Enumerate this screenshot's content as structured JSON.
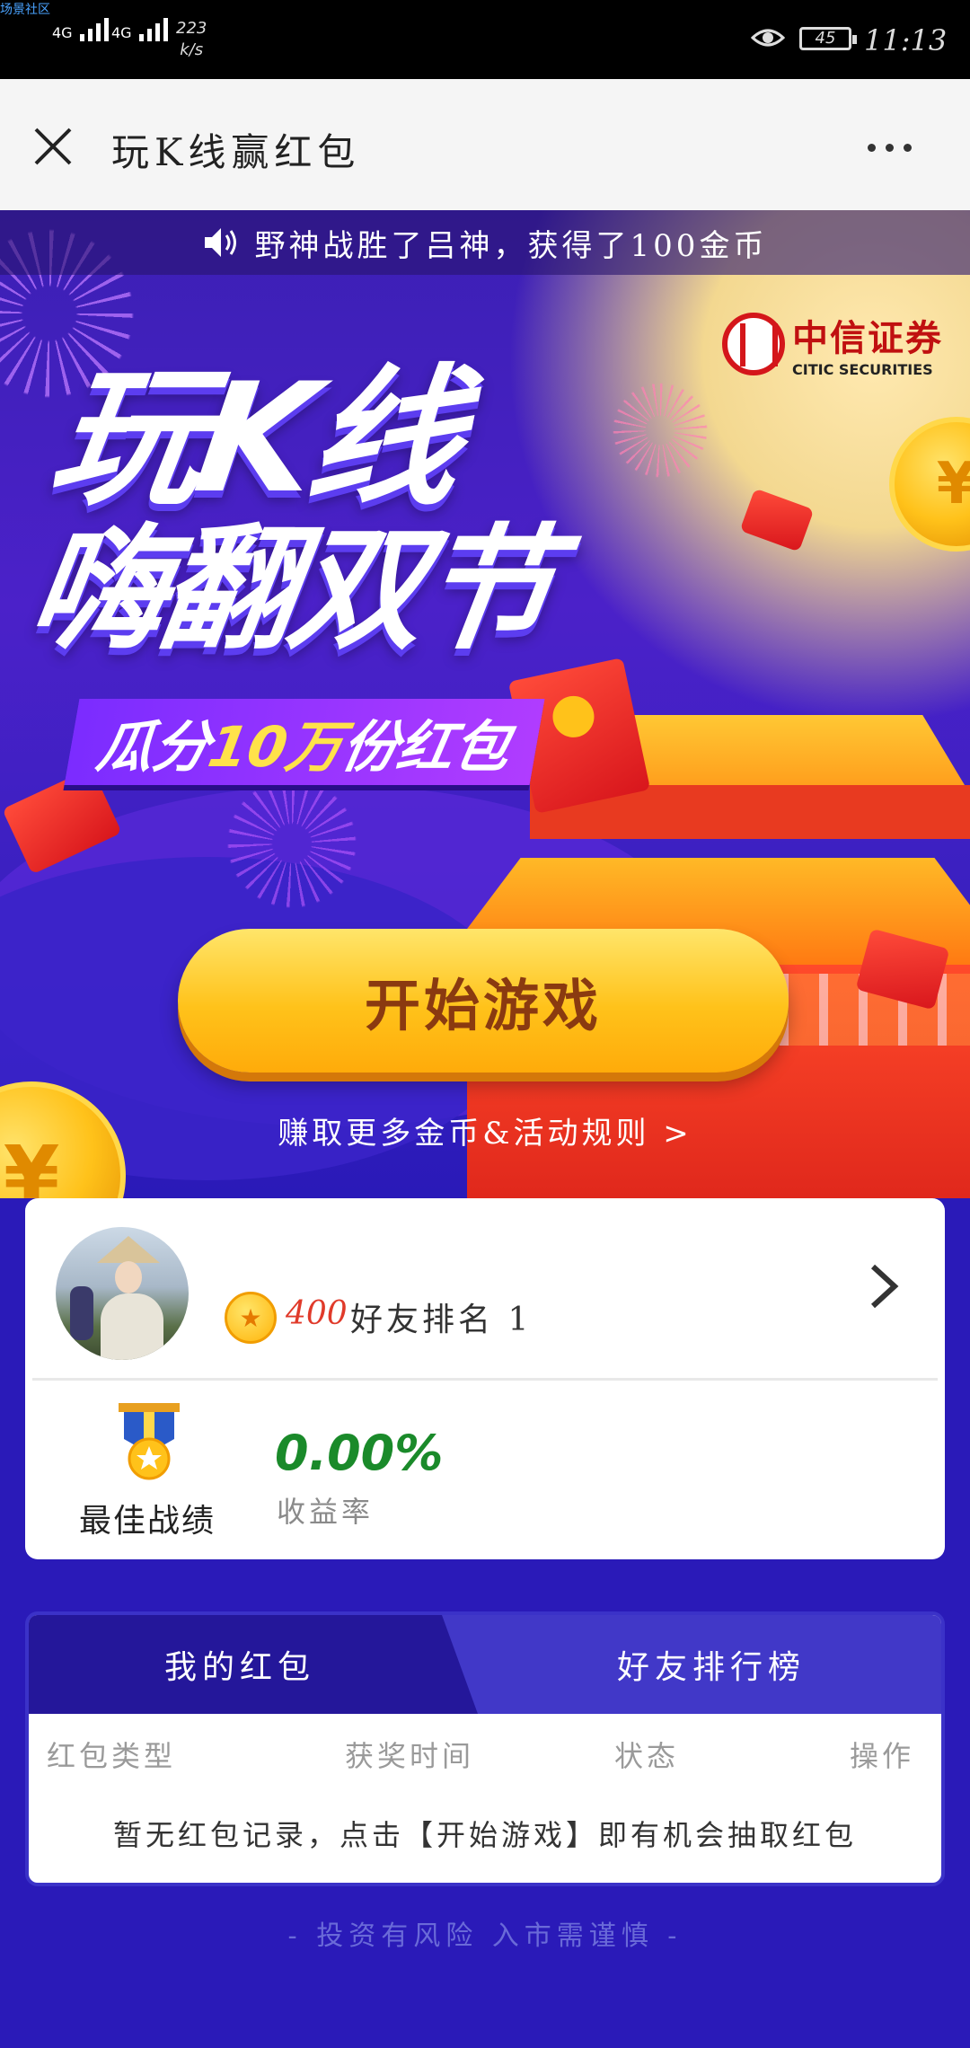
{
  "status_bar": {
    "corner_tag": "场景社区",
    "signal1": "4G",
    "signal2": "4G",
    "net_speed_value": "223",
    "net_speed_unit": "k/s",
    "battery": "45",
    "time": "11:13"
  },
  "title_bar": {
    "title": "玩K线赢红包"
  },
  "hero": {
    "ticker": "野神战胜了吕神，获得了100金币",
    "logo_cn": "中信证券",
    "logo_en": "CITIC SECURITIES",
    "title_line1": "玩K线",
    "title_line2": "嗨翻双节",
    "subtitle_prefix": "瓜分",
    "subtitle_highlight": "10万",
    "subtitle_suffix": "份红包",
    "coin_symbol": "¥",
    "start_button": "开始游戏",
    "rules_link": "赚取更多金币&活动规则 >"
  },
  "profile": {
    "coin_symbol": "★",
    "coins": "400",
    "friend_rank": "好友排名 1",
    "best_label": "最佳战绩",
    "rate_value": "0.00%",
    "rate_label": "收益率"
  },
  "records": {
    "tabs": [
      {
        "label": "我的红包",
        "active": true
      },
      {
        "label": "好友排行榜",
        "active": false
      }
    ],
    "columns": [
      "红包类型",
      "获奖时间",
      "状态",
      "操作"
    ],
    "empty_message": "暂无红包记录，点击【开始游戏】即有机会抽取红包"
  },
  "footer": {
    "risk_note": "- 投资有风险 入市需谨慎 -"
  },
  "colors": {
    "background": "#2a1ab8",
    "start_button": "#ffc21a",
    "tab_active": "#24179a",
    "rate_green": "#1a8a2a",
    "coin_red": "#e03a2a"
  }
}
